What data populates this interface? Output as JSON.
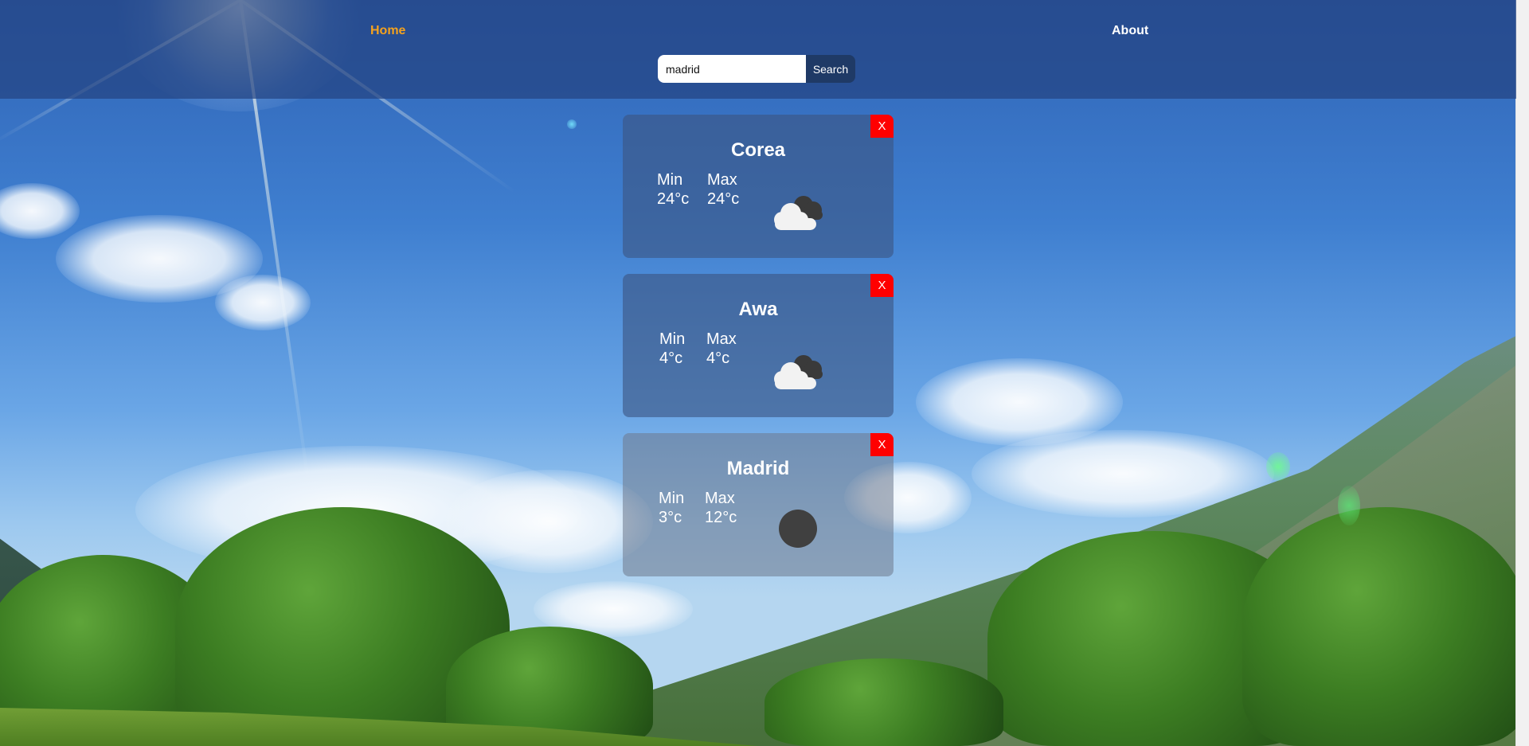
{
  "nav": {
    "home_label": "Home",
    "about_label": "About"
  },
  "search": {
    "value": "madrid",
    "button_label": "Search"
  },
  "cards": [
    {
      "close_label": "X",
      "city": "Corea",
      "min_label": "Min",
      "min_value": "24°c",
      "max_label": "Max",
      "max_value": "24°c",
      "icon": "cloudy-icon"
    },
    {
      "close_label": "X",
      "city": "Awa",
      "min_label": "Min",
      "min_value": "4°c",
      "max_label": "Max",
      "max_value": "4°c",
      "icon": "cloudy-icon"
    },
    {
      "close_label": "X",
      "city": "Madrid",
      "min_label": "Min",
      "min_value": "3°c",
      "max_label": "Max",
      "max_value": "12°c",
      "icon": "clear-night-icon"
    }
  ],
  "colors": {
    "accent_nav": "#f4a21e",
    "close_button": "#ff0000",
    "search_button": "#1f3a66"
  }
}
